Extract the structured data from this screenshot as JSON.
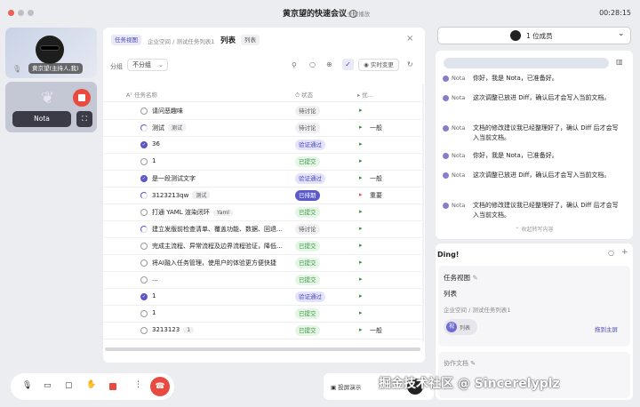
{
  "window": {
    "title": "黄京望的快速会议",
    "fullscreen": "全屏播放",
    "timer": "00:28:15"
  },
  "participants": {
    "host_label": "黄京望(主持人,我)",
    "nota_label": "Nota"
  },
  "task": {
    "breadcrumb_chip": "任务视图",
    "breadcrumb_path": "企业空间 / 测试任务列表1",
    "view_title": "列表",
    "view_badge": "列表",
    "group_label": "分组",
    "group_value": "不分组",
    "realtime": "实时变更",
    "col_name": "任务名称",
    "col_status": "状态",
    "col_priority": "优...",
    "rows": [
      {
        "name": "请问恶趣味",
        "tag": "",
        "status": "待讨论",
        "skind": "todo",
        "check": "none",
        "priority": ""
      },
      {
        "name": "测试",
        "tag": "测试",
        "status": "待讨论",
        "skind": "todo",
        "check": "prog",
        "priority": "一般"
      },
      {
        "name": "36",
        "tag": "",
        "status": "验证通过",
        "skind": "verify",
        "check": "done",
        "priority": ""
      },
      {
        "name": "1",
        "tag": "",
        "status": "已提交",
        "skind": "sub",
        "check": "none",
        "priority": ""
      },
      {
        "name": "是一段测试文字",
        "tag": "",
        "status": "验证通过",
        "skind": "verify",
        "check": "done",
        "priority": "一般"
      },
      {
        "name": "3123213qw",
        "tag": "测试",
        "status": "已排期",
        "skind": "pend",
        "check": "prog",
        "priority": "重要"
      },
      {
        "name": "打通 YAML 渲染闭环",
        "tag": "Yaml",
        "status": "已提交",
        "skind": "sub",
        "check": "none",
        "priority": ""
      },
      {
        "name": "建立发版前检查清单、覆盖功能、数据、回退...",
        "tag": "",
        "status": "待讨论",
        "skind": "todo",
        "check": "prog",
        "priority": ""
      },
      {
        "name": "完成主流程、异常流程及边界流程验证，降低...",
        "tag": "",
        "status": "已提交",
        "skind": "sub",
        "check": "none",
        "priority": ""
      },
      {
        "name": "将AI融入任务管理，使用户的体验更方便快捷",
        "tag": "",
        "status": "已提交",
        "skind": "sub",
        "check": "none",
        "priority": ""
      },
      {
        "name": "...",
        "tag": "",
        "status": "已提交",
        "skind": "sub",
        "check": "none",
        "priority": ""
      },
      {
        "name": "1",
        "tag": "",
        "status": "验证通过",
        "skind": "verify",
        "check": "done",
        "priority": ""
      },
      {
        "name": "1",
        "tag": "",
        "status": "已提交",
        "skind": "sub",
        "check": "none",
        "priority": ""
      },
      {
        "name": "3213123",
        "tag": "1",
        "status": "已提交",
        "skind": "sub",
        "check": "none",
        "priority": "一般"
      }
    ]
  },
  "chat": {
    "members": "1 位成员",
    "messages": [
      {
        "who": "Nota",
        "text": "你好，我是 Nota，已准备好。"
      },
      {
        "who": "Nota",
        "text": "这次调整已放进 Diff，确认后才会写入当前文档。"
      },
      {
        "who": "Nota",
        "text": "文档的修改建议我已经整理好了，确认 Diff 后才会写入当前文档。"
      },
      {
        "who": "Nota",
        "text": "你好，我是 Nota，已准备好。"
      },
      {
        "who": "Nota",
        "text": "这次调整已放进 Diff，确认后才会写入当前文档。"
      },
      {
        "who": "Nota",
        "text": "文档的修改建议我已经整理好了，确认 Diff 后才会写入当前文档。"
      }
    ],
    "collapse": "收起转写内容"
  },
  "ding": {
    "title": "Ding!",
    "card_title": "任务视图",
    "card_view": "列表",
    "card_path": "企业空间 / 测试任务列表1",
    "card_chip_a": "视",
    "card_chip_b": "列表",
    "drag": "拖到主屏",
    "card2_title": "协作文档"
  },
  "controls": {
    "share": "投屏演示"
  },
  "watermark": "掘金技术社区 @ Sincerelyplz"
}
